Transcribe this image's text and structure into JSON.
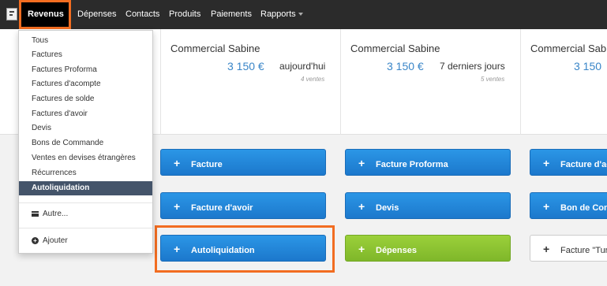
{
  "nav": {
    "active_label": "Revenus",
    "items": [
      "Dépenses",
      "Contacts",
      "Produits",
      "Paiements",
      "Rapports"
    ]
  },
  "stats": [
    {
      "title": "Commercial Sabine",
      "amount": "3 150 €",
      "period": "aujourd'hui",
      "count": "4 ventes"
    },
    {
      "title": "Commercial Sabine",
      "amount": "3 150 €",
      "period": "7 derniers jours",
      "count": "5 ventes"
    },
    {
      "title": "Commercial Sabi",
      "amount": "3 150"
    }
  ],
  "buttons": [
    {
      "label": "Facture"
    },
    {
      "label": "Facture Proforma"
    },
    {
      "label": "Facture d'ac"
    },
    {
      "label": "Facture d'avoir"
    },
    {
      "label": "Devis"
    },
    {
      "label": "Bon de Com"
    },
    {
      "label": "Autoliquidation"
    },
    {
      "label": "Dépenses"
    },
    {
      "label": "Facture \"Tur"
    }
  ],
  "dropdown": {
    "items": [
      "Tous",
      "Factures",
      "Factures Proforma",
      "Factures d'acompte",
      "Factures de solde",
      "Factures d'avoir",
      "Devis",
      "Bons de Commande",
      "Ventes en devises étrangères",
      "Récurrences",
      "Autoliquidation"
    ],
    "other_label": "Autre...",
    "add_label": "Ajouter"
  },
  "colors": {
    "accent": "#f26d21",
    "amount": "#3a86c8",
    "blue_button": "#2087d8",
    "green_button": "#8cc232",
    "active_item": "#44546a"
  }
}
